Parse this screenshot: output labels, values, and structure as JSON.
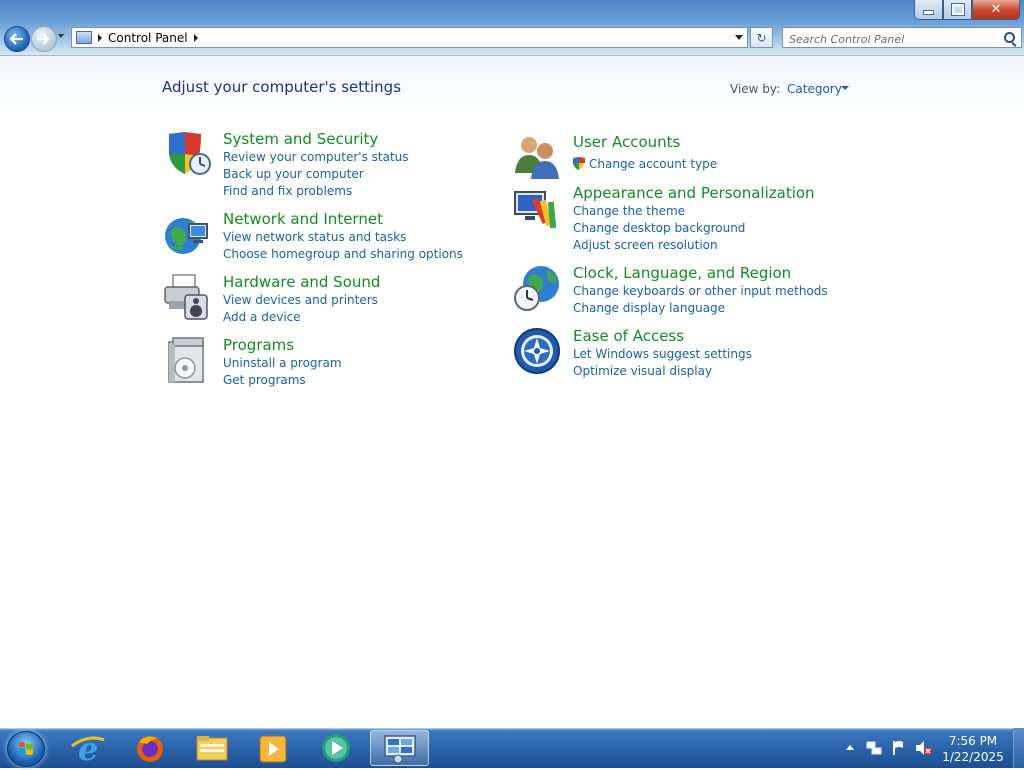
{
  "window": {
    "address_crumb": "Control Panel",
    "search_placeholder": "Search Control Panel"
  },
  "header": {
    "title": "Adjust your computer's settings",
    "view_by_label": "View by:",
    "view_by_value": "Category"
  },
  "categories": [
    {
      "title": "System and Security",
      "icon": "shield-icon",
      "links": [
        "Review your computer's status",
        "Back up your computer",
        "Find and fix problems"
      ]
    },
    {
      "title": "Network and Internet",
      "icon": "network-globe-icon",
      "links": [
        "View network status and tasks",
        "Choose homegroup and sharing options"
      ]
    },
    {
      "title": "Hardware and Sound",
      "icon": "printer-speaker-icon",
      "links": [
        "View devices and printers",
        "Add a device"
      ]
    },
    {
      "title": "Programs",
      "icon": "programs-box-icon",
      "links": [
        "Uninstall a program",
        "Get programs"
      ]
    },
    {
      "title": "User Accounts",
      "icon": "users-icon",
      "links": [
        "Change account type"
      ]
    },
    {
      "title": "Appearance and Personalization",
      "icon": "monitor-paint-icon",
      "links": [
        "Change the theme",
        "Change desktop background",
        "Adjust screen resolution"
      ]
    },
    {
      "title": "Clock, Language, and Region",
      "icon": "globe-clock-icon",
      "links": [
        "Change keyboards or other input methods",
        "Change display language"
      ]
    },
    {
      "title": "Ease of Access",
      "icon": "ease-of-access-icon",
      "links": [
        "Let Windows suggest settings",
        "Optimize visual display"
      ]
    }
  ],
  "taskbar": {
    "pinned": [
      "internet-explorer-icon",
      "firefox-icon",
      "file-explorer-icon",
      "media-player-icon",
      "media-center-icon",
      "control-panel-icon"
    ],
    "time": "7:56 PM",
    "date": "1/22/2025"
  },
  "colors": {
    "category_title": "#168a26",
    "link": "#1e5fa8",
    "page_title": "#1e3287"
  }
}
